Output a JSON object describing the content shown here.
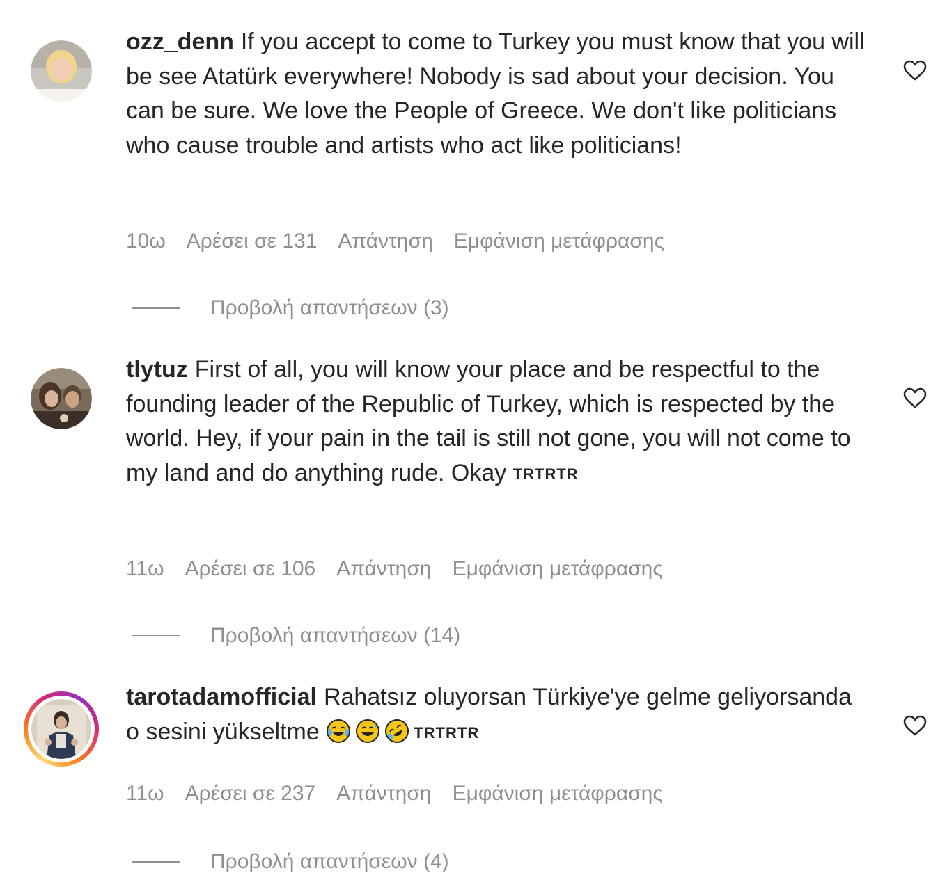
{
  "comments": [
    {
      "username": "ozz_denn",
      "text": "If you accept to come to Turkey you must know that you will be see Atatürk everywhere! Nobody is sad about your decision. You can be sure. We love the People of Greece. We don't like politicians who cause trouble and artists who act like politicians!",
      "time": "10ω",
      "likes": "Αρέσει σε 131",
      "reply": "Απάντηση",
      "translate": "Εμφάνιση μετάφρασης",
      "view_replies": "Προβολή απαντήσεων (3)"
    },
    {
      "username": "tlytuz",
      "text": "First of all, you will know your place and be respectful to the founding leader of the Republic of Turkey, which is respected by the world. Hey, if your pain in the tail is still not gone, you will not come to my land and do anything rude. Okay",
      "flags": "TRTRTR",
      "time": "11ω",
      "likes": "Αρέσει σε 106",
      "reply": "Απάντηση",
      "translate": "Εμφάνιση μετάφρασης",
      "view_replies": "Προβολή απαντήσεων (14)"
    },
    {
      "username": "tarotadamofficial",
      "text": "Rahatsız oluyorsan Türkiye'ye gelme geliyorsanda o sesini yükseltme",
      "emojis": [
        "face-with-tears-of-joy",
        "grinning-face-with-sweat",
        "rolling-on-the-floor-laughing"
      ],
      "flags": "TRTRTR",
      "time": "11ω",
      "likes": "Αρέσει σε 237",
      "reply": "Απάντηση",
      "translate": "Εμφάνιση μετάφρασης",
      "view_replies": "Προβολή απαντήσεων (4)"
    }
  ],
  "icons": {
    "like": "heart-outline-icon"
  },
  "colors": {
    "text": "#262626",
    "secondary": "#8e8e8e",
    "story_ring": [
      "#feda75",
      "#fa7e1e",
      "#d62976",
      "#962fbf"
    ]
  }
}
